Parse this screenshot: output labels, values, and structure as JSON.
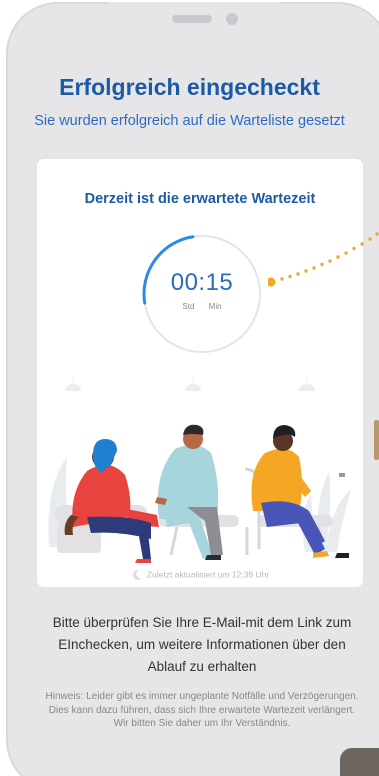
{
  "header": {
    "title": "Erfolgreich eingecheckt",
    "subtitle": "Sie wurden erfolgreich auf die Warteliste gesetzt"
  },
  "wait_card": {
    "heading": "Derzeit ist die erwartete Wartezeit",
    "timer": {
      "value": "00:15",
      "unit_hours": "Std",
      "unit_minutes": "Min",
      "ring_progress": 0.25
    },
    "last_updated": "Zuletzt aktualisiert um 12:38 Uhr"
  },
  "instructions": "Bitte überprüfen Sie Ihre E-Mail-mit dem Link zum EInchecken, um weitere Informationen über den Ablauf  zu erhalten",
  "note": "Hinweis: Leider gibt es immer ungeplante Notfälle und Verzögerungen. Dies kann dazu führen, dass sich Ihre erwartete Wartezeit verlängert. Wir bitten Sie daher um Ihr Verständnis.",
  "colors": {
    "primary": "#1d5aa6",
    "accent": "#2b8ae6",
    "dot": "#f5a623"
  },
  "icons": {
    "last_updated": "moon-icon"
  }
}
